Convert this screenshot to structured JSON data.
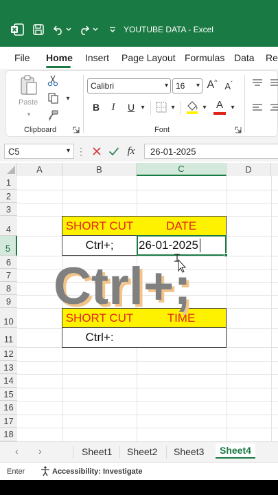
{
  "title_bar": {
    "document_title": "YOUTUBE DATA",
    "separator": "-",
    "app_name": "Excel",
    "icons": [
      "excel-logo-icon",
      "save-icon",
      "undo-icon",
      "redo-icon",
      "customize-toolbar-icon"
    ],
    "background_color": "#197a43"
  },
  "ribbon_tabs": {
    "items": [
      "File",
      "Home",
      "Insert",
      "Page Layout",
      "Formulas",
      "Data",
      "Rev"
    ],
    "active": "Home"
  },
  "ribbon": {
    "clipboard": {
      "paste_label": "Paste",
      "group_label": "Clipboard",
      "icons": [
        "paste-icon",
        "cut-icon",
        "copy-icon",
        "format-painter-icon",
        "dialog-launcher-icon"
      ]
    },
    "font": {
      "font_name": "Calibri",
      "font_size": "16",
      "group_label": "Font",
      "bold": "B",
      "italic": "I",
      "underline": "U",
      "increase_font": "A",
      "decrease_font": "A",
      "font_color_letter": "A",
      "font_color": "#e0241b",
      "fill_color": "#fff200"
    }
  },
  "formula_bar": {
    "name_box": "C5",
    "fx_label": "fx",
    "content": "26-01-2025"
  },
  "grid": {
    "columns": [
      "A",
      "B",
      "C",
      "D"
    ],
    "selected_column": "C",
    "rows": [
      "1",
      "2",
      "3",
      "4",
      "5",
      "6",
      "7",
      "8",
      "9",
      "10",
      "11",
      "12",
      "13",
      "14",
      "15",
      "16",
      "17",
      "18"
    ],
    "selected_row": "5",
    "cells": {
      "B4": "SHORT CUT",
      "C4": "DATE",
      "B5": "Ctrl+;",
      "C5": "26-01-2025",
      "B10": "SHORT CUT",
      "C10": "TIME",
      "B11": "Ctrl+:",
      "C11": ""
    },
    "highlight_color": "#fff200",
    "header_text_color": "#e0241b"
  },
  "overlay_text": "Ctrl+;",
  "sheet_tabs": {
    "items": [
      "Sheet1",
      "Sheet2",
      "Sheet3",
      "Sheet4"
    ],
    "active": "Sheet4"
  },
  "status_bar": {
    "mode": "Enter",
    "accessibility": "Accessibility: Investigate"
  }
}
